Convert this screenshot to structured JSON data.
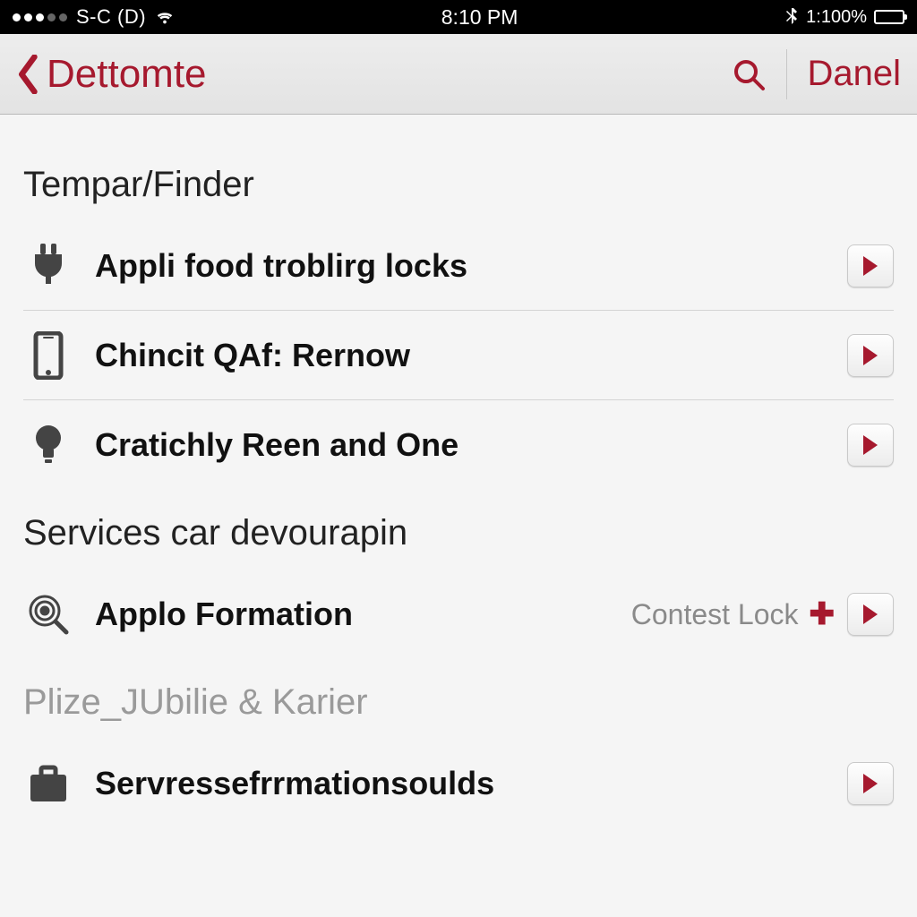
{
  "status": {
    "carrier": "S-C (D)",
    "time": "8:10 PM",
    "battery_text": "100%",
    "battery_prefix": "1:"
  },
  "nav": {
    "back_label": "Dettomte",
    "user": "Danel"
  },
  "sections": [
    {
      "title": "Tempar/Finder",
      "dim": false,
      "items": [
        {
          "icon": "plug-icon",
          "label": "Appli food troblirg locks",
          "divider": true
        },
        {
          "icon": "phone-icon",
          "label": "Chincit QAf: Rernow",
          "divider": true
        },
        {
          "icon": "bulb-icon",
          "label": "Cratichly Reen and One",
          "divider": false
        }
      ]
    },
    {
      "title": "Services car devourapin",
      "dim": false,
      "items": [
        {
          "icon": "target-icon",
          "label": "Applo Formation",
          "meta": "Contest Lock",
          "plus": true,
          "divider": false
        }
      ]
    },
    {
      "title": "Plize_JUbilie & Karier",
      "dim": true,
      "items": [
        {
          "icon": "briefcase-icon",
          "label": "Servressefrrmationsoulds",
          "divider": false
        }
      ]
    }
  ]
}
